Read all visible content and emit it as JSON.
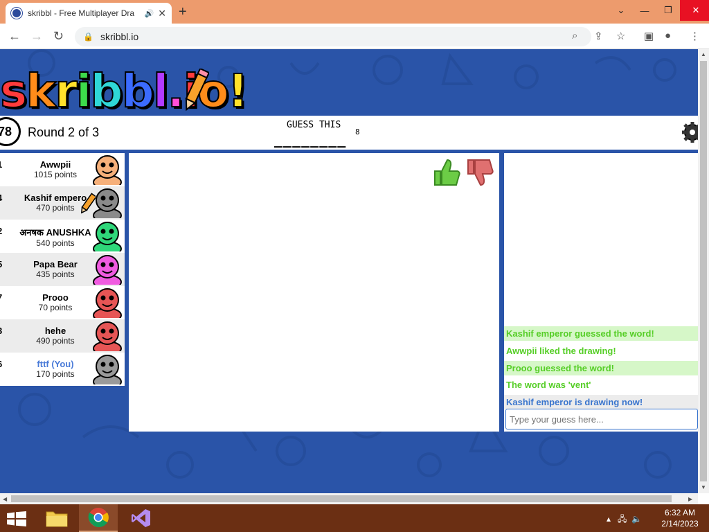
{
  "browser": {
    "tab_title": "skribbl - Free Multiplayer Dra",
    "url": "skribbl.io",
    "accent": "#ed9b6d"
  },
  "header": {
    "logo_text": "skribbl.io!",
    "timer": "78",
    "round": "Round 2 of 3",
    "guess_label": "GUESS THIS",
    "word_blanks": "________",
    "word_length": "8"
  },
  "players": [
    {
      "rank": "1",
      "name": "Awwpii",
      "points": "1015 points",
      "you": false,
      "color": "#f6b07a"
    },
    {
      "rank": "4",
      "name": "Kashif empero",
      "points": "470 points",
      "you": false,
      "color": "#8a8a8a",
      "drawing": true
    },
    {
      "rank": "2",
      "name": "अनषक ANUSHKA",
      "points": "540 points",
      "you": false,
      "color": "#2fd77a"
    },
    {
      "rank": "5",
      "name": "Papa Bear",
      "points": "435 points",
      "you": false,
      "color": "#f05be0"
    },
    {
      "rank": "7",
      "name": "Prooo",
      "points": "70 points",
      "you": false,
      "color": "#e65555"
    },
    {
      "rank": "3",
      "name": "hehe",
      "points": "490 points",
      "you": false,
      "color": "#e65555"
    },
    {
      "rank": "6",
      "name": "fttf (You)",
      "points": "170 points",
      "you": true,
      "color": "#9a9a9a"
    }
  ],
  "chat": {
    "messages": [
      {
        "text": "Kashif emperor guessed the word!",
        "style": "green"
      },
      {
        "text": "Awwpii liked the drawing!",
        "style": "greenw"
      },
      {
        "text": "Prooo guessed the word!",
        "style": "green"
      },
      {
        "text": "The word was 'vent'",
        "style": "greenw"
      },
      {
        "text": "Kashif emperor is drawing now!",
        "style": "blue"
      }
    ],
    "input_placeholder": "Type your guess here..."
  },
  "taskbar": {
    "time": "6:32 AM",
    "date": "2/14/2023"
  }
}
